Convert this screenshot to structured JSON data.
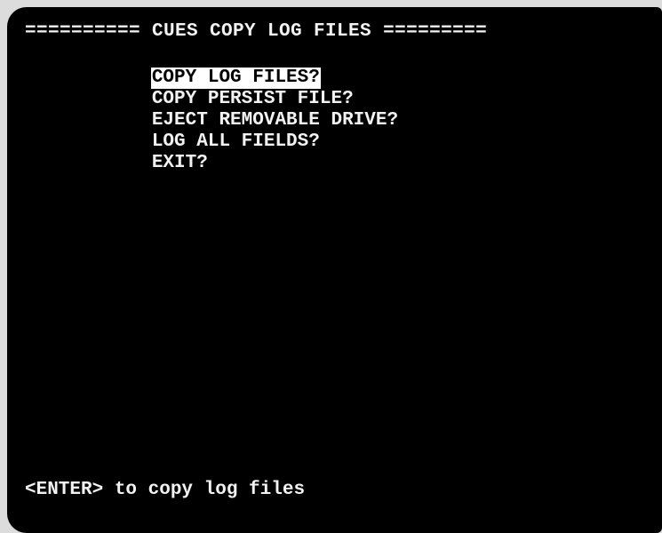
{
  "screen": {
    "title": "========== CUES COPY LOG FILES =========",
    "menu": {
      "items": [
        {
          "label": "COPY LOG FILES?",
          "selected": true
        },
        {
          "label": "COPY PERSIST FILE?",
          "selected": false
        },
        {
          "label": "EJECT REMOVABLE DRIVE?",
          "selected": false
        },
        {
          "label": "LOG ALL FIELDS?",
          "selected": false
        },
        {
          "label": "EXIT?",
          "selected": false
        }
      ]
    },
    "status_hint": "<ENTER> to copy log files"
  },
  "colors": {
    "background": "#000000",
    "text": "#f2f2f2",
    "highlight_bg": "#ffffff",
    "highlight_text": "#000000"
  }
}
